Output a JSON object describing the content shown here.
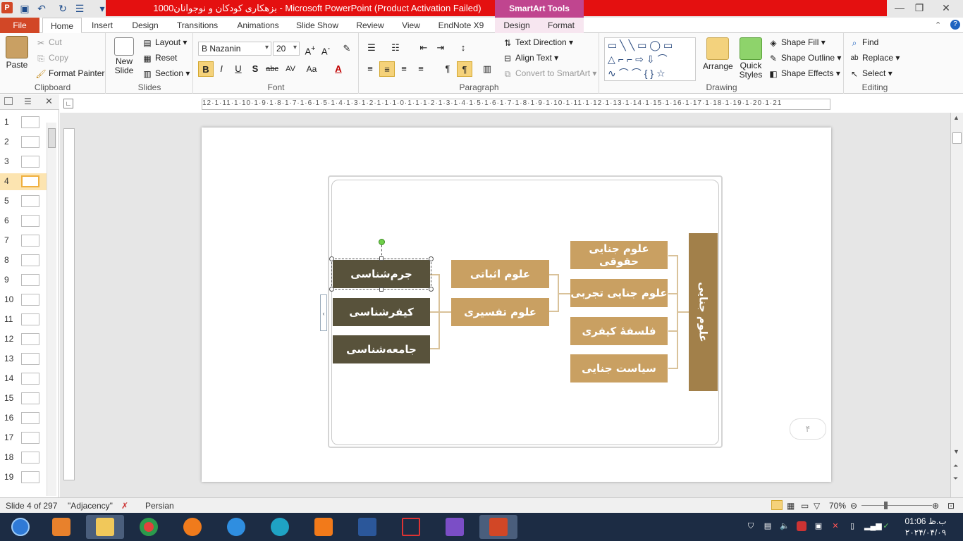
{
  "window": {
    "title": "1000بزهکاری کودکان و نوجوانان  -  Microsoft PowerPoint (Product Activation Failed)",
    "context_tab_group": "SmartArt Tools"
  },
  "tabs": [
    "File",
    "Home",
    "Insert",
    "Design",
    "Transitions",
    "Animations",
    "Slide Show",
    "Review",
    "View",
    "EndNote X9",
    "Design",
    "Format"
  ],
  "ribbon": {
    "clipboard": {
      "label": "Clipboard",
      "paste": "Paste",
      "cut": "Cut",
      "copy": "Copy",
      "format_painter": "Format Painter"
    },
    "slides": {
      "label": "Slides",
      "new_slide_1": "New",
      "new_slide_2": "Slide",
      "layout": "Layout",
      "reset": "Reset",
      "section": "Section"
    },
    "font": {
      "label": "Font",
      "name": "B Nazanin",
      "size": "20"
    },
    "paragraph": {
      "label": "Paragraph",
      "text_direction": "Text Direction",
      "align_text": "Align Text",
      "convert": "Convert to SmartArt"
    },
    "drawing": {
      "label": "Drawing",
      "arrange": "Arrange",
      "quick_styles_1": "Quick",
      "quick_styles_2": "Styles",
      "shape_fill": "Shape Fill",
      "shape_outline": "Shape Outline",
      "shape_effects": "Shape Effects"
    },
    "editing": {
      "label": "Editing",
      "find": "Find",
      "replace": "Replace",
      "select": "Select"
    }
  },
  "thumbnails": [
    "1",
    "2",
    "3",
    "4",
    "5",
    "6",
    "7",
    "8",
    "9",
    "10",
    "11",
    "12",
    "13",
    "14",
    "15",
    "16",
    "17",
    "18",
    "19"
  ],
  "ruler_text": "12·1·11·1·10·1·9·1·8·1·7·1·6·1·5·1·4·1·3·1·2·1·1·1·0·1·1·1·2·1·3·1·4·1·5·1·6·1·7·1·8·1·9·1·10·1·11·1·12·1·13·1·14·1·15·1·16·1·17·1·18·1·19·1·20·1·21",
  "smartart": {
    "root": "علوم جنایی",
    "level2": [
      "علوم جنایی حقوقی",
      "علوم جنایی تجربی",
      "فلسفهٔ کیفری",
      "سیاست جنایی"
    ],
    "level3": [
      "علوم اثباتی",
      "علوم تفسیری"
    ],
    "level4": [
      "جرم‌شناسی",
      "کیفرشناسی",
      "جامعه‌شناسی"
    ]
  },
  "slide_number": "۴",
  "status": {
    "slide": "Slide 4 of 297",
    "theme": "\"Adjacency\"",
    "language": "Persian",
    "zoom": "70%"
  },
  "clock": {
    "time": "01:06 ب.ظ",
    "date": "۲۰۲۴/۰۴/۰۹"
  }
}
